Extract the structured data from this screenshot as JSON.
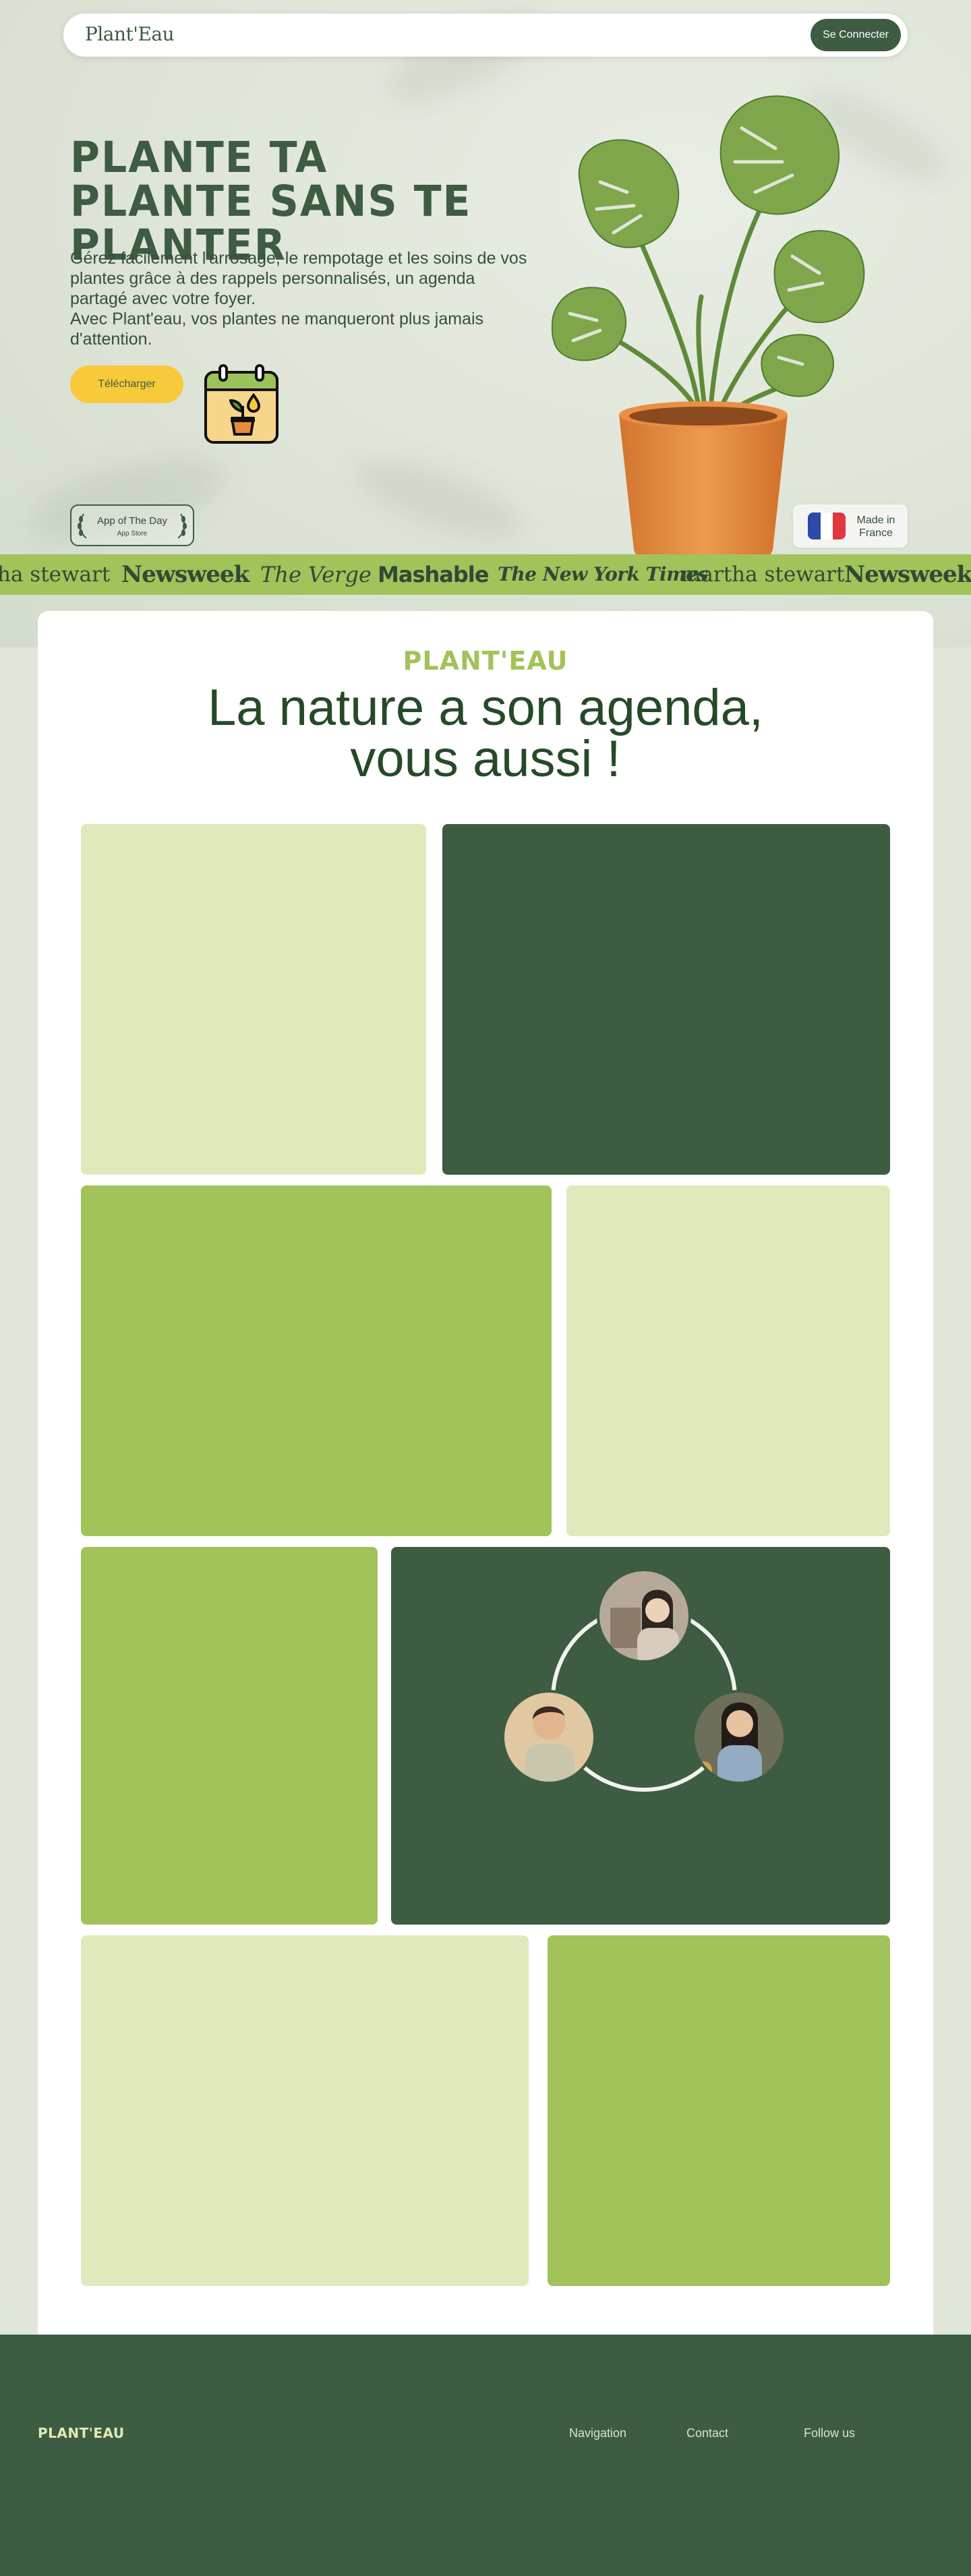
{
  "header": {
    "logo": "Plant'Eau",
    "connect_label": "Se Connecter"
  },
  "hero": {
    "title": "PLANTE TA PLANTE SANS TE PLANTER",
    "description": "Gérez facilement l'arrosage, le rempotage et les soins de vos plantes grâce à des rappels personnalisés, un agenda partagé avec votre foyer.\nAvec Plant'eau, vos plantes ne manqueront plus jamais d'attention.",
    "download_label": "Télécharger",
    "app_badge": {
      "title": "App of The Day",
      "subtitle": "App Store"
    },
    "made_in": "Made in\nFrance",
    "flag_colors": [
      "#2d4aa8",
      "#ffffff",
      "#e0383d"
    ],
    "icons": [
      "calendar-plant-icon",
      "monstera-plant-image",
      "laurel-icon",
      "france-flag-icon"
    ]
  },
  "press": [
    "ha stewart",
    "Newsweek",
    "The Verge",
    "Mashable",
    "The New York Times",
    "martha stewart",
    "Newsweek"
  ],
  "section": {
    "brand": "PLANT'EAU",
    "heading": "La nature a son agenda,\nvous aussi !"
  },
  "colors": {
    "dark_green": "#3d5c42",
    "lime": "#a2c25a",
    "pale_green": "#deeabc",
    "yellow": "#f8c93a",
    "background": "#e0e6da"
  },
  "footer": {
    "logo": "PLANT'EAU",
    "links": [
      "Navigation",
      "Contact",
      "Follow us"
    ]
  }
}
